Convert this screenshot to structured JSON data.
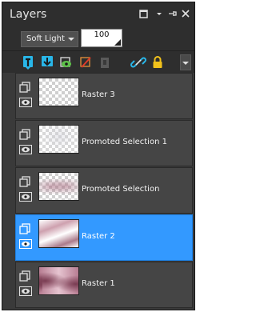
{
  "panel": {
    "title": "Layers"
  },
  "blend": {
    "mode": "Soft Light",
    "opacity": "100"
  },
  "toolbar": {
    "tools": [
      "new-raster-layer-icon",
      "new-vector-layer-icon",
      "visibility-toggle-icon",
      "delete-layer-icon",
      "mask-icon",
      "link-icon",
      "lock-icon"
    ]
  },
  "layers": [
    {
      "name": "Raster 3",
      "selected": false
    },
    {
      "name": "Promoted Selection 1",
      "selected": false
    },
    {
      "name": "Promoted Selection",
      "selected": false
    },
    {
      "name": "Raster 2",
      "selected": true
    },
    {
      "name": "Raster 1",
      "selected": false
    }
  ],
  "colors": {
    "panel_bg": "#3a3a3a",
    "row_bg": "#454545",
    "selected_bg": "#3399ff",
    "accent_cyan": "#29b6e8",
    "accent_green": "#5ec24a",
    "accent_orange": "#e8923a",
    "lock_yellow": "#f2c21b"
  }
}
